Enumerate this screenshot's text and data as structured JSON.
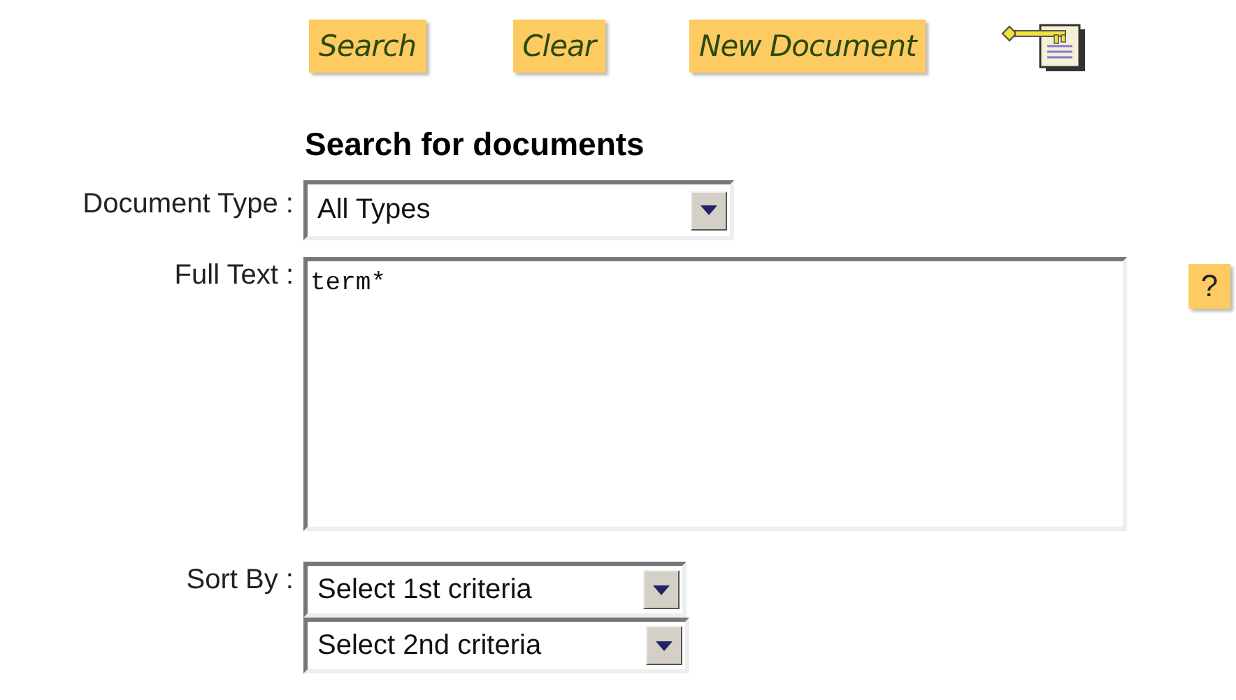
{
  "toolbar": {
    "buttons": [
      {
        "label": "Search"
      },
      {
        "label": "Clear"
      },
      {
        "label": "New Document"
      }
    ]
  },
  "heading": "Search for documents",
  "fields": [
    {
      "kind": "select",
      "label": "Document Type :",
      "value": "All Types"
    },
    {
      "kind": "textarea",
      "label": "Full Text :",
      "value": "term*",
      "help": "?"
    },
    {
      "kind": "selects",
      "label": "Sort By :",
      "values": [
        "Select 1st criteria",
        "Select 2nd criteria"
      ]
    }
  ]
}
